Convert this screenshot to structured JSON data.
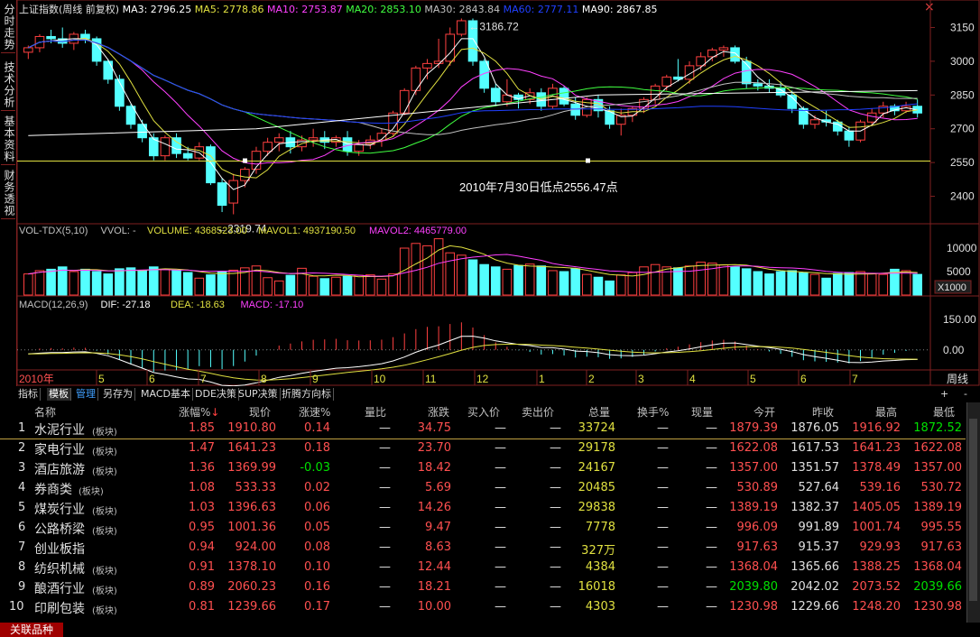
{
  "sidebar": {
    "tabs": [
      "分时走势",
      "技术分析",
      "基本资料",
      "财务透视"
    ]
  },
  "header": {
    "title": "上证指数(周线 前复权)",
    "ma": [
      {
        "label": "MA3: 2796.25",
        "color": "#ffffff"
      },
      {
        "label": "MA5: 2778.86",
        "color": "#e0e040"
      },
      {
        "label": "MA10: 2753.87",
        "color": "#ff40ff"
      },
      {
        "label": "MA20: 2853.10",
        "color": "#40ff40"
      },
      {
        "label": "MA30: 2843.84",
        "color": "#c0c0c0"
      },
      {
        "label": "MA60: 2777.11",
        "color": "#2040ff"
      },
      {
        "label": "MA90: 2867.85",
        "color": "#ffffff"
      }
    ]
  },
  "chart_data": {
    "type": "candlestick",
    "price_axis": {
      "ticks": [
        "3150",
        "3000",
        "2850",
        "2700",
        "2550",
        "2400"
      ],
      "ylim": [
        2290,
        3200
      ]
    },
    "annotations": {
      "high": "3186.72",
      "low": "2319.74",
      "note": "2010年7月30日低点2556.47点"
    },
    "volume": {
      "header": [
        {
          "label": "VOL-TDX(5,10)",
          "color": "#c0c0c0"
        },
        {
          "label": "VVOL: -",
          "color": "#c0c0c0"
        },
        {
          "label": "VOLUME: 4368523.00",
          "color": "#e0e040"
        },
        {
          "label": "MAVOL1: 4937190.50",
          "color": "#e0e040"
        },
        {
          "label": "MAVOL2: 4465779.00",
          "color": "#ff40ff"
        }
      ],
      "ticks": [
        "10000",
        "5000"
      ],
      "unit": "X1000",
      "values": [
        4500,
        5200,
        5500,
        6000,
        5000,
        5500,
        5000,
        4500,
        5600,
        5800,
        5200,
        6000,
        5400,
        5200,
        4800,
        3600,
        4300,
        5000,
        5300,
        5800,
        6200,
        3700,
        3000,
        4200,
        5700,
        4000,
        3500,
        3800,
        4000,
        4200,
        4300,
        3400,
        4500,
        10000,
        11000,
        10500,
        12000,
        9000,
        8500,
        7500,
        6500,
        6000,
        5500,
        6300,
        6600,
        6200,
        5200,
        5000,
        5600,
        4400,
        3800,
        3000,
        4300,
        4800,
        6000,
        6500,
        6000,
        5800,
        6200,
        7000,
        6800,
        6400,
        6000,
        5600,
        5000,
        4500,
        5000,
        5200,
        4700,
        4400,
        3600,
        4600,
        4800,
        5000,
        4500,
        4400,
        5500,
        5200,
        4400
      ],
      "ylim": [
        0,
        12500
      ]
    },
    "macd": {
      "header": [
        {
          "label": "MACD(12,26,9)",
          "color": "#c0c0c0"
        },
        {
          "label": "DIF: -27.18",
          "color": "#ffffff"
        },
        {
          "label": "DEA: -18.63",
          "color": "#e0e040"
        },
        {
          "label": "MACD: -17.10",
          "color": "#ff40ff"
        }
      ],
      "ticks": [
        "150.00",
        "0.00"
      ],
      "ylim": [
        -90,
        190
      ]
    },
    "time_axis": {
      "labels": [
        {
          "text": "2010年",
          "color": "#ff5050"
        },
        {
          "text": "5",
          "color": "#e0e040"
        },
        {
          "text": "6",
          "color": "#e0e040"
        },
        {
          "text": "7",
          "color": "#e0e040"
        },
        {
          "text": "8",
          "color": "#e0e040"
        },
        {
          "text": "9",
          "color": "#e0e040"
        },
        {
          "text": "10",
          "color": "#e0e040"
        },
        {
          "text": "11",
          "color": "#e0e040"
        },
        {
          "text": "12",
          "color": "#e0e040"
        },
        {
          "text": "1",
          "color": "#e0e040"
        },
        {
          "text": "2",
          "color": "#e0e040"
        },
        {
          "text": "3",
          "color": "#e0e040"
        },
        {
          "text": "4",
          "color": "#e0e040"
        },
        {
          "text": "5",
          "color": "#e0e040"
        },
        {
          "text": "6",
          "color": "#e0e040"
        },
        {
          "text": "7",
          "color": "#e0e040"
        }
      ],
      "period": "周线"
    },
    "candles": [
      [
        3040,
        3070,
        3010,
        3060
      ],
      [
        3060,
        3120,
        3040,
        3110
      ],
      [
        3110,
        3140,
        3080,
        3100
      ],
      [
        3100,
        3150,
        3060,
        3080
      ],
      [
        3080,
        3130,
        3050,
        3120
      ],
      [
        3120,
        3140,
        3080,
        3100
      ],
      [
        3100,
        3110,
        2980,
        3000
      ],
      [
        3000,
        3010,
        2900,
        2920
      ],
      [
        2920,
        2940,
        2780,
        2800
      ],
      [
        2800,
        2810,
        2700,
        2720
      ],
      [
        2720,
        2740,
        2640,
        2660
      ],
      [
        2660,
        2680,
        2560,
        2580
      ],
      [
        2580,
        2670,
        2560,
        2660
      ],
      [
        2660,
        2680,
        2570,
        2590
      ],
      [
        2590,
        2620,
        2560,
        2570
      ],
      [
        2570,
        2640,
        2560,
        2620
      ],
      [
        2620,
        2630,
        2450,
        2460
      ],
      [
        2460,
        2480,
        2330,
        2360
      ],
      [
        2370,
        2500,
        2320,
        2470
      ],
      [
        2470,
        2530,
        2440,
        2520
      ],
      [
        2520,
        2620,
        2500,
        2600
      ],
      [
        2600,
        2660,
        2580,
        2640
      ],
      [
        2640,
        2680,
        2600,
        2660
      ],
      [
        2660,
        2690,
        2590,
        2620
      ],
      [
        2620,
        2670,
        2600,
        2650
      ],
      [
        2650,
        2700,
        2620,
        2660
      ],
      [
        2660,
        2690,
        2610,
        2640
      ],
      [
        2640,
        2670,
        2620,
        2660
      ],
      [
        2660,
        2690,
        2580,
        2600
      ],
      [
        2600,
        2650,
        2580,
        2630
      ],
      [
        2630,
        2670,
        2610,
        2650
      ],
      [
        2650,
        2700,
        2620,
        2680
      ],
      [
        2680,
        2780,
        2670,
        2770
      ],
      [
        2770,
        2880,
        2760,
        2870
      ],
      [
        2870,
        2980,
        2850,
        2970
      ],
      [
        2970,
        3010,
        2920,
        2990
      ],
      [
        2990,
        3100,
        2970,
        3000
      ],
      [
        3000,
        3150,
        2980,
        3120
      ],
      [
        3120,
        3190,
        3110,
        3180
      ],
      [
        3180,
        3190,
        2980,
        3000
      ],
      [
        3000,
        3010,
        2860,
        2880
      ],
      [
        2880,
        2900,
        2800,
        2820
      ],
      [
        2820,
        2920,
        2800,
        2850
      ],
      [
        2850,
        2860,
        2790,
        2830
      ],
      [
        2830,
        2880,
        2810,
        2860
      ],
      [
        2860,
        2880,
        2780,
        2800
      ],
      [
        2800,
        2900,
        2790,
        2880
      ],
      [
        2880,
        2890,
        2800,
        2810
      ],
      [
        2810,
        2840,
        2740,
        2760
      ],
      [
        2760,
        2840,
        2750,
        2830
      ],
      [
        2830,
        2850,
        2750,
        2780
      ],
      [
        2780,
        2800,
        2700,
        2720
      ],
      [
        2720,
        2790,
        2670,
        2760
      ],
      [
        2760,
        2800,
        2730,
        2790
      ],
      [
        2790,
        2840,
        2770,
        2830
      ],
      [
        2830,
        2900,
        2810,
        2890
      ],
      [
        2890,
        2940,
        2870,
        2930
      ],
      [
        2930,
        3010,
        2910,
        2920
      ],
      [
        2920,
        3000,
        2900,
        2980
      ],
      [
        2980,
        3040,
        2960,
        3020
      ],
      [
        3020,
        3060,
        3000,
        3050
      ],
      [
        3050,
        3070,
        3020,
        3060
      ],
      [
        3060,
        3070,
        2990,
        3000
      ],
      [
        3000,
        3020,
        2880,
        2900
      ],
      [
        2900,
        2920,
        2870,
        2890
      ],
      [
        2890,
        2920,
        2860,
        2880
      ],
      [
        2880,
        2910,
        2840,
        2850
      ],
      [
        2850,
        2870,
        2770,
        2790
      ],
      [
        2790,
        2800,
        2700,
        2720
      ],
      [
        2720,
        2760,
        2700,
        2740
      ],
      [
        2740,
        2780,
        2710,
        2730
      ],
      [
        2730,
        2740,
        2670,
        2690
      ],
      [
        2690,
        2710,
        2620,
        2650
      ],
      [
        2650,
        2740,
        2640,
        2730
      ],
      [
        2730,
        2790,
        2720,
        2770
      ],
      [
        2770,
        2820,
        2750,
        2800
      ],
      [
        2800,
        2810,
        2760,
        2780
      ],
      [
        2780,
        2820,
        2770,
        2800
      ],
      [
        2800,
        2830,
        2750,
        2770
      ]
    ]
  },
  "tabs": [
    {
      "label": "指标",
      "style": "plain"
    },
    {
      "label": "模板",
      "style": "sel"
    },
    {
      "label": "管理",
      "style": "blue"
    },
    {
      "label": "另存为",
      "style": "plain"
    },
    {
      "label": "MACD基本",
      "style": "plain"
    },
    {
      "label": "DDE决策",
      "style": "plain"
    },
    {
      "label": "SUP决策",
      "style": "plain"
    },
    {
      "label": "折腾方向标",
      "style": "plain"
    }
  ],
  "table": {
    "columns": [
      "名称",
      "涨幅%↓",
      "现价",
      "涨速%",
      "量比",
      "涨跌",
      "买入价",
      "卖出价",
      "总量",
      "换手%",
      "现量",
      "今开",
      "昨收",
      "最高",
      "最低"
    ],
    "rows": [
      {
        "idx": "1",
        "name": "水泥行业",
        "sub": "(板块)",
        "chg": "1.85",
        "price": "1910.80",
        "speed": "0.14",
        "vr": "—",
        "diff": "34.75",
        "bid": "—",
        "ask": "—",
        "vol": "33724",
        "turn": "—",
        "cur": "—",
        "open": "1879.39",
        "prev": "1876.05",
        "high": "1916.92",
        "low": "1872.52"
      },
      {
        "idx": "2",
        "name": "家电行业",
        "sub": "(板块)",
        "chg": "1.47",
        "price": "1641.23",
        "speed": "0.18",
        "vr": "—",
        "diff": "23.70",
        "bid": "—",
        "ask": "—",
        "vol": "29178",
        "turn": "—",
        "cur": "—",
        "open": "1622.08",
        "prev": "1617.53",
        "high": "1641.23",
        "low": "1622.08"
      },
      {
        "idx": "3",
        "name": "酒店旅游",
        "sub": "(板块)",
        "chg": "1.36",
        "price": "1369.99",
        "speed": "-0.03",
        "vr": "—",
        "diff": "18.42",
        "bid": "—",
        "ask": "—",
        "vol": "24167",
        "turn": "—",
        "cur": "—",
        "open": "1357.00",
        "prev": "1351.57",
        "high": "1378.49",
        "low": "1357.00"
      },
      {
        "idx": "4",
        "name": "券商类",
        "sub": "(板块)",
        "chg": "1.08",
        "price": "533.33",
        "speed": "0.02",
        "vr": "—",
        "diff": "5.69",
        "bid": "—",
        "ask": "—",
        "vol": "20485",
        "turn": "—",
        "cur": "—",
        "open": "530.89",
        "prev": "527.64",
        "high": "539.16",
        "low": "530.72"
      },
      {
        "idx": "5",
        "name": "煤炭行业",
        "sub": "(板块)",
        "chg": "1.03",
        "price": "1396.63",
        "speed": "0.06",
        "vr": "—",
        "diff": "14.26",
        "bid": "—",
        "ask": "—",
        "vol": "29838",
        "turn": "—",
        "cur": "—",
        "open": "1389.19",
        "prev": "1382.37",
        "high": "1405.05",
        "low": "1389.19"
      },
      {
        "idx": "6",
        "name": "公路桥梁",
        "sub": "(板块)",
        "chg": "0.95",
        "price": "1001.36",
        "speed": "0.05",
        "vr": "—",
        "diff": "9.47",
        "bid": "—",
        "ask": "—",
        "vol": "7778",
        "turn": "—",
        "cur": "—",
        "open": "996.09",
        "prev": "991.89",
        "high": "1001.74",
        "low": "995.55"
      },
      {
        "idx": "7",
        "name": "创业板指",
        "sub": "",
        "chg": "0.94",
        "price": "924.00",
        "speed": "0.08",
        "vr": "—",
        "diff": "8.63",
        "bid": "—",
        "ask": "—",
        "vol": "327万",
        "turn": "—",
        "cur": "—",
        "open": "917.63",
        "prev": "915.37",
        "high": "929.93",
        "low": "917.63"
      },
      {
        "idx": "8",
        "name": "纺织机械",
        "sub": "(板块)",
        "chg": "0.91",
        "price": "1378.10",
        "speed": "0.10",
        "vr": "—",
        "diff": "12.44",
        "bid": "—",
        "ask": "—",
        "vol": "4384",
        "turn": "—",
        "cur": "—",
        "open": "1368.04",
        "prev": "1365.66",
        "high": "1388.25",
        "low": "1368.04"
      },
      {
        "idx": "9",
        "name": "酿酒行业",
        "sub": "(板块)",
        "chg": "0.89",
        "price": "2060.23",
        "speed": "0.16",
        "vr": "—",
        "diff": "18.21",
        "bid": "—",
        "ask": "—",
        "vol": "16018",
        "turn": "—",
        "cur": "—",
        "open": "2039.80",
        "prev": "2042.02",
        "high": "2073.52",
        "low": "2039.66"
      },
      {
        "idx": "10",
        "name": "印刷包装",
        "sub": "(板块)",
        "chg": "0.81",
        "price": "1239.66",
        "speed": "0.17",
        "vr": "—",
        "diff": "10.00",
        "bid": "—",
        "ask": "—",
        "vol": "4303",
        "turn": "—",
        "cur": "—",
        "open": "1230.98",
        "prev": "1229.66",
        "high": "1248.20",
        "low": "1230.98"
      }
    ]
  },
  "bottom_tab": "关联品种",
  "window_controls": {
    "close": "×",
    "plus": "+",
    "minus": "-"
  }
}
